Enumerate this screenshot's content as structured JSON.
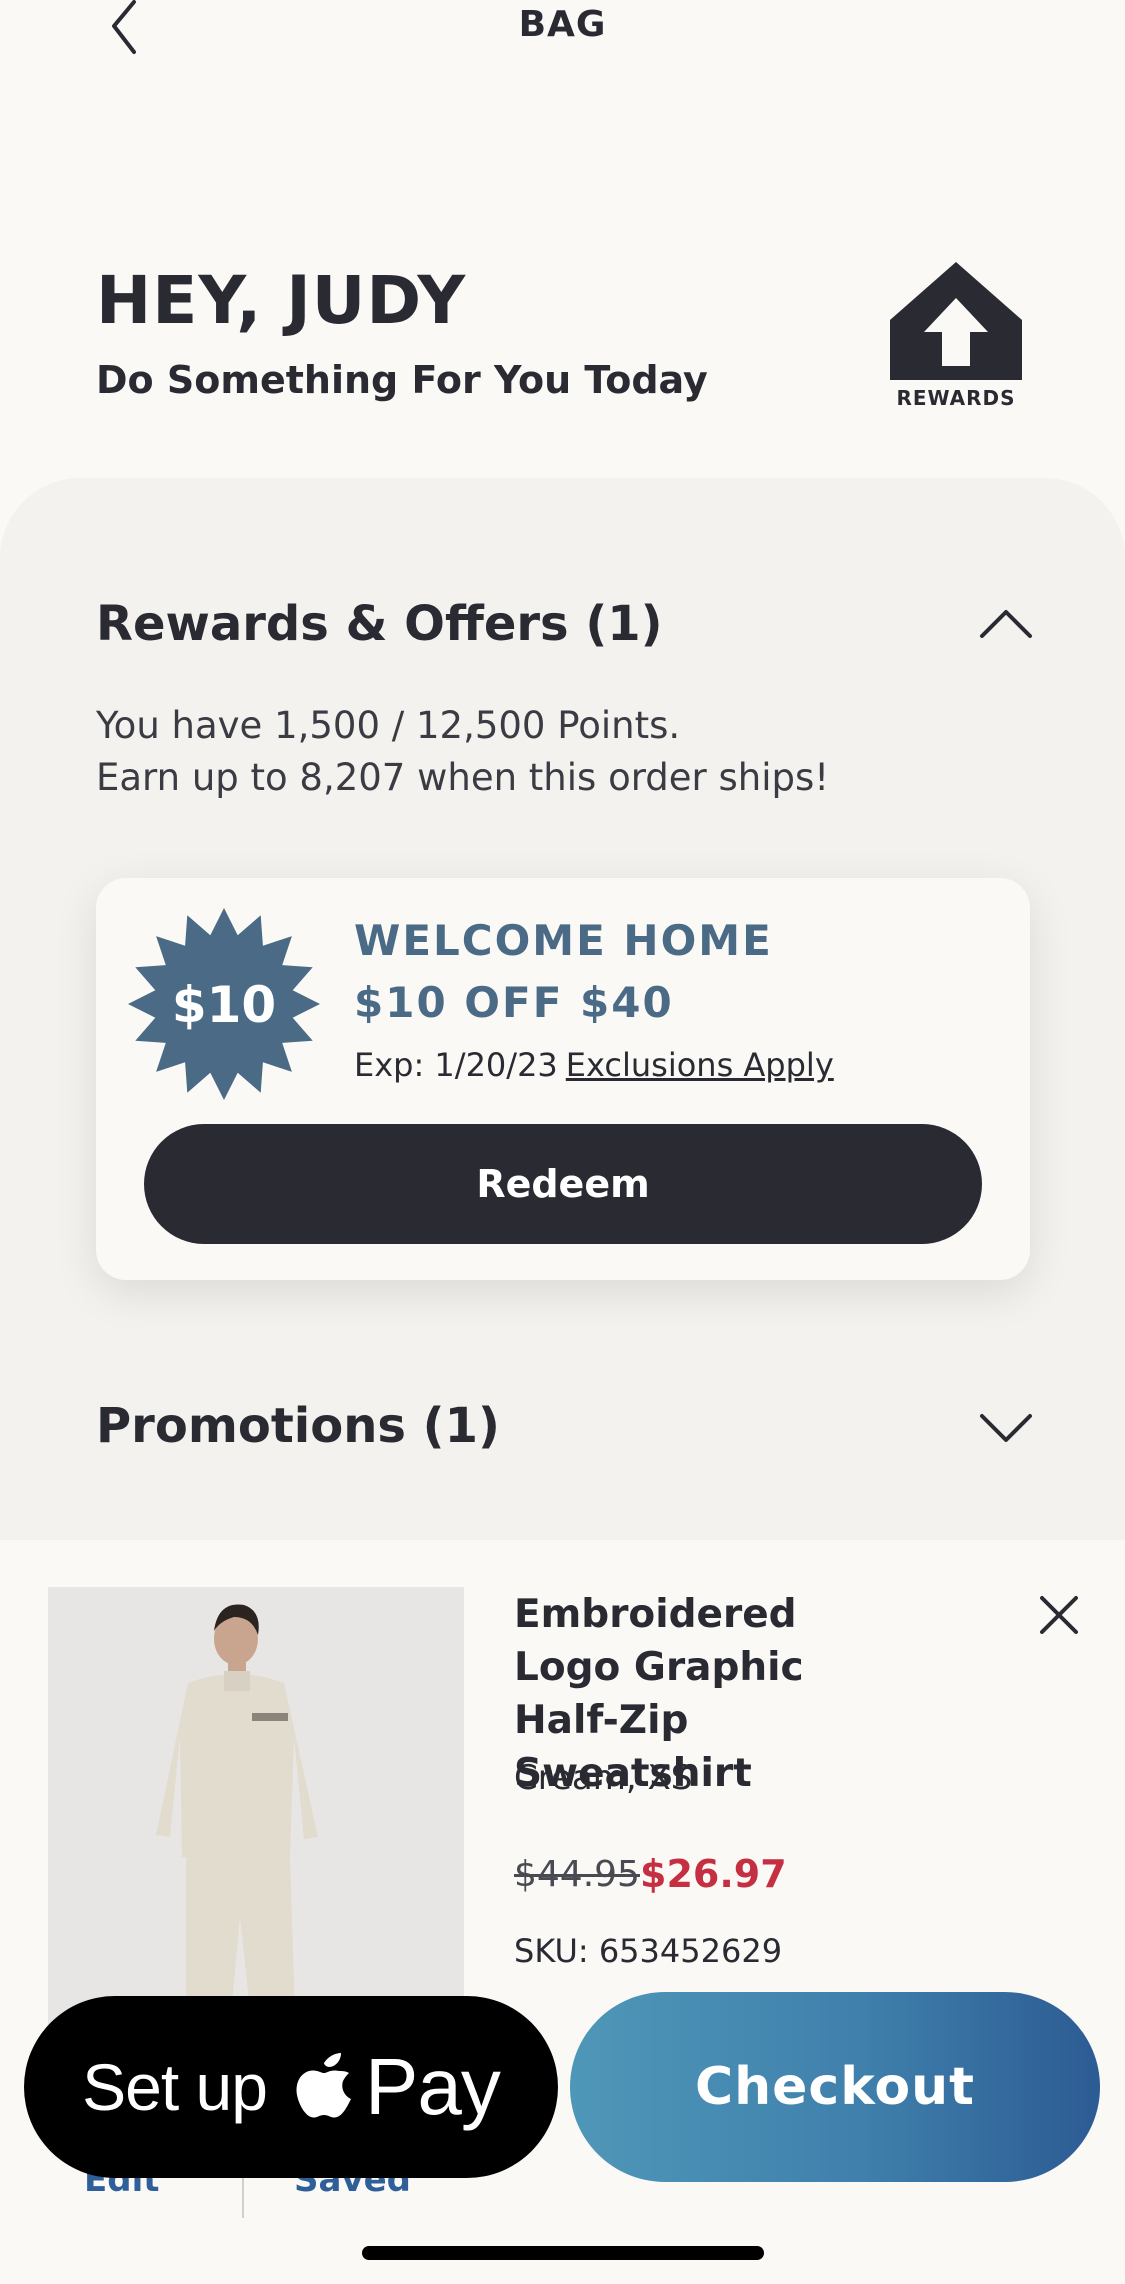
{
  "nav": {
    "title": "BAG"
  },
  "greeting": {
    "title": "HEY, JUDY",
    "subtitle": "Do Something For You Today"
  },
  "rewards_logo": {
    "text": "REWARDS"
  },
  "rewards": {
    "heading": "Rewards & Offers (1)",
    "points_line": "You have 1,500 / 12,500 Points.",
    "earn_line": "Earn up to 8,207 when this order ships!",
    "offer": {
      "badge": "$10",
      "title": "WELCOME HOME",
      "subtitle": "$10 OFF $40",
      "exp": "Exp: 1/20/23",
      "exclusions": "Exclusions Apply",
      "redeem_label": "Redeem"
    }
  },
  "promotions": {
    "heading": "Promotions (1)"
  },
  "product": {
    "name": "Embroidered Logo Graphic Half-Zip Sweatshirt",
    "variant": "Cream, XS",
    "price_old": "$44.95",
    "price_new": "$26.97",
    "sku": "SKU: 653452629"
  },
  "under_actions": {
    "edit": "Edit",
    "saved": "Saved"
  },
  "footer": {
    "applepay_setup": "Set up",
    "applepay_pay": "Pay",
    "checkout_label": "Checkout"
  },
  "colors": {
    "offer_accent": "#4a6a85",
    "sale_price": "#c43041",
    "dark": "#2a2a33",
    "checkout_start": "#4f97b8",
    "checkout_end": "#2c5b93"
  }
}
